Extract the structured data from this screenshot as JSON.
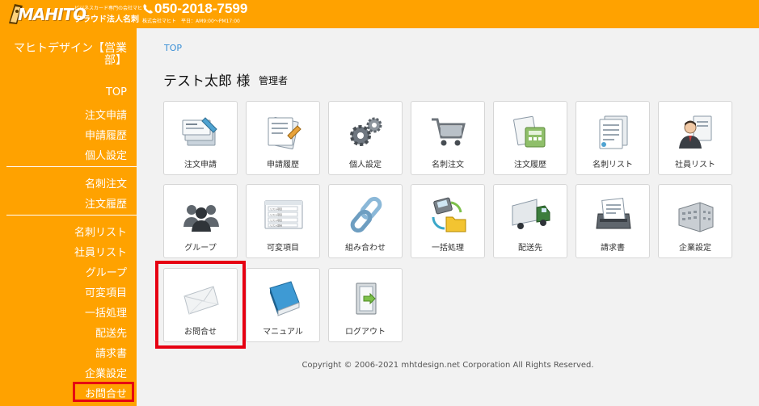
{
  "header": {
    "logo_text": "MAHITO",
    "logo_small": "ビジネスカード専門の会社マヒト",
    "logo_sub": "クラウド法人名刺",
    "phone": "050-2018-7599",
    "hours": "株式会社マヒト　平日：AM9:00〜PM17:00"
  },
  "sidebar": {
    "company": "マヒトデザイン【営業部】",
    "items": [
      {
        "label": "TOP"
      },
      {
        "label": "注文申請"
      },
      {
        "label": "申請履歴"
      },
      {
        "label": "個人設定"
      },
      {
        "label": "名刺注文"
      },
      {
        "label": "注文履歴"
      },
      {
        "label": "名刺リスト"
      },
      {
        "label": "社員リスト"
      },
      {
        "label": "グループ"
      },
      {
        "label": "可変項目"
      },
      {
        "label": "一括処理"
      },
      {
        "label": "配送先"
      },
      {
        "label": "請求書"
      },
      {
        "label": "企業設定"
      },
      {
        "label": "お問合せ"
      }
    ]
  },
  "main": {
    "breadcrumb": "TOP",
    "user_name": "テスト太郎 様",
    "role": "管理者",
    "tiles": [
      {
        "label": "注文申請",
        "icon": "order-request-icon"
      },
      {
        "label": "申請履歴",
        "icon": "request-history-icon"
      },
      {
        "label": "個人設定",
        "icon": "gears-icon"
      },
      {
        "label": "名刺注文",
        "icon": "cart-icon"
      },
      {
        "label": "注文履歴",
        "icon": "order-history-icon"
      },
      {
        "label": "名刺リスト",
        "icon": "card-list-icon"
      },
      {
        "label": "社員リスト",
        "icon": "employee-icon"
      },
      {
        "label": "グループ",
        "icon": "group-icon"
      },
      {
        "label": "可変項目",
        "icon": "variable-items-icon"
      },
      {
        "label": "組み合わせ",
        "icon": "link-icon"
      },
      {
        "label": "一括処理",
        "icon": "batch-icon"
      },
      {
        "label": "配送先",
        "icon": "truck-icon"
      },
      {
        "label": "請求書",
        "icon": "invoice-icon"
      },
      {
        "label": "企業設定",
        "icon": "building-icon"
      },
      {
        "label": "お問合せ",
        "icon": "envelope-icon"
      },
      {
        "label": "マニュアル",
        "icon": "manual-icon"
      },
      {
        "label": "ログアウト",
        "icon": "logout-icon"
      }
    ],
    "icon_list_labels": [
      "リスト項目",
      "リスト項目",
      "リスト項目",
      "リスト項目"
    ],
    "copyright": "Copyright © 2006-2021 mhtdesign.net Corporation All Rights Reserved."
  },
  "colors": {
    "brand": "#ffa200",
    "highlight": "#e60012",
    "link": "#3a8fd6"
  }
}
